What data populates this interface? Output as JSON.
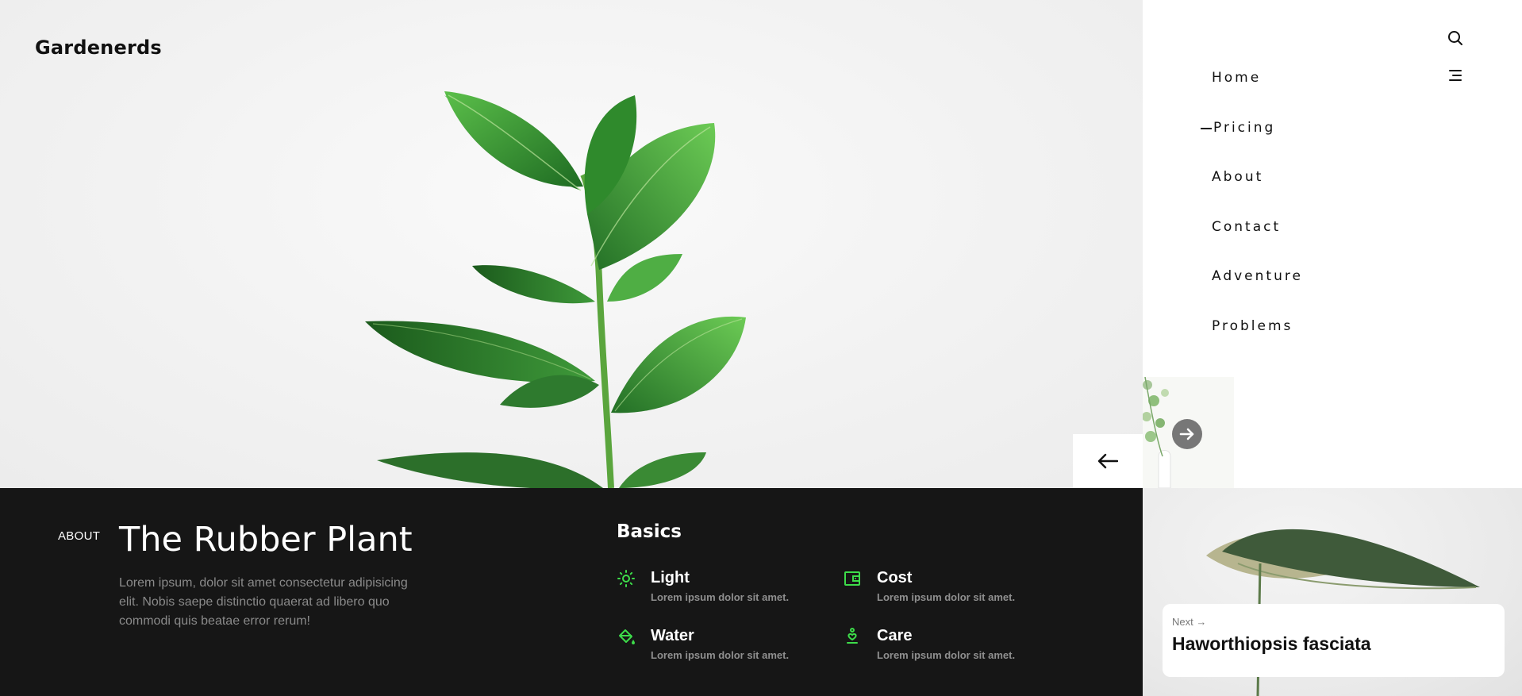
{
  "brand": {
    "name": "Gardenerds"
  },
  "nav": {
    "items": [
      {
        "label": "Home",
        "active": false
      },
      {
        "label": "Pricing",
        "active": true
      },
      {
        "label": "About",
        "active": false
      },
      {
        "label": "Contact",
        "active": false
      },
      {
        "label": "Adventure",
        "active": false
      },
      {
        "label": "Problems",
        "active": false
      }
    ],
    "icons": {
      "search": "search-icon",
      "menu": "menu-icon"
    }
  },
  "hero": {
    "prev_icon": "arrow-left-icon",
    "thumb_next_icon": "arrow-right-circle-icon"
  },
  "about": {
    "kicker": "ABOUT",
    "title": "The Rubber Plant",
    "description": "Lorem ipsum, dolor sit amet consectetur adipisicing elit. Nobis saepe distinctio quaerat ad libero quo commodi quis beatae error rerum!"
  },
  "basics": {
    "title": "Basics",
    "features": [
      {
        "icon": "sun-icon",
        "label": "Light",
        "sub": "Lorem ipsum dolor sit amet."
      },
      {
        "icon": "wallet-icon",
        "label": "Cost",
        "sub": "Lorem ipsum dolor sit amet."
      },
      {
        "icon": "paint-bucket-icon",
        "label": "Water",
        "sub": "Lorem ipsum dolor sit amet."
      },
      {
        "icon": "hand-heart-icon",
        "label": "Care",
        "sub": "Lorem ipsum dolor sit amet."
      }
    ]
  },
  "next": {
    "kicker": "Next →",
    "title": "Haworthiopsis fasciata"
  },
  "colors": {
    "accent": "#3ddc4a",
    "dark": "#161616",
    "white": "#ffffff"
  }
}
